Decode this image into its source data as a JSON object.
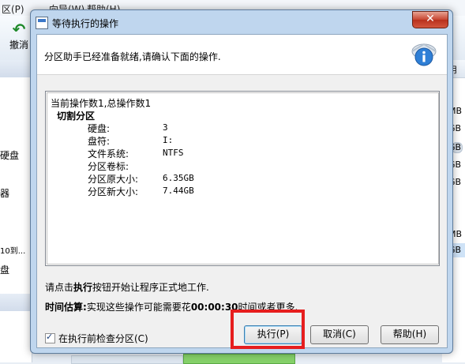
{
  "background": {
    "menu": [
      "区(P)",
      "向导(W)",
      "帮助(H)"
    ],
    "undo_label": "撤消",
    "left_labels": [
      "硬盘",
      "器",
      "10到...",
      "盘"
    ],
    "right_header": "用",
    "right_sizes": [
      "MB",
      "GB",
      "GB",
      "GB",
      "GB",
      "MB",
      "GB"
    ]
  },
  "dialog": {
    "title": "等待执行的操作",
    "close_glyph": "✕",
    "header_text": "分区助手已经准备就绪,请确认下面的操作.",
    "operations": {
      "summary": "当前操作数1,总操作数1",
      "operation_name": "切割分区",
      "details": [
        {
          "key": "硬盘:",
          "value": "3"
        },
        {
          "key": "盘符:",
          "value": "I:"
        },
        {
          "key": "文件系统:",
          "value": "NTFS"
        },
        {
          "key": "分区卷标:",
          "value": ""
        },
        {
          "key": "分区原大小:",
          "value": "6.35GB"
        },
        {
          "key": "分区新大小:",
          "value": "7.44GB"
        }
      ]
    },
    "hint": {
      "prefix": "请点击",
      "bold": "执行",
      "suffix": "按钮开始让程序正式地工作."
    },
    "estimate": {
      "label": "时间估算:",
      "text_before": "实现这些操作可能需要花",
      "time": "00:00:30",
      "text_after": "时间或者更多."
    },
    "checkbox": {
      "label": "在执行前检查分区(C)",
      "checked": true
    },
    "buttons": {
      "execute": "执行(P)",
      "cancel": "取消(C)",
      "help": "帮助(H)"
    }
  }
}
